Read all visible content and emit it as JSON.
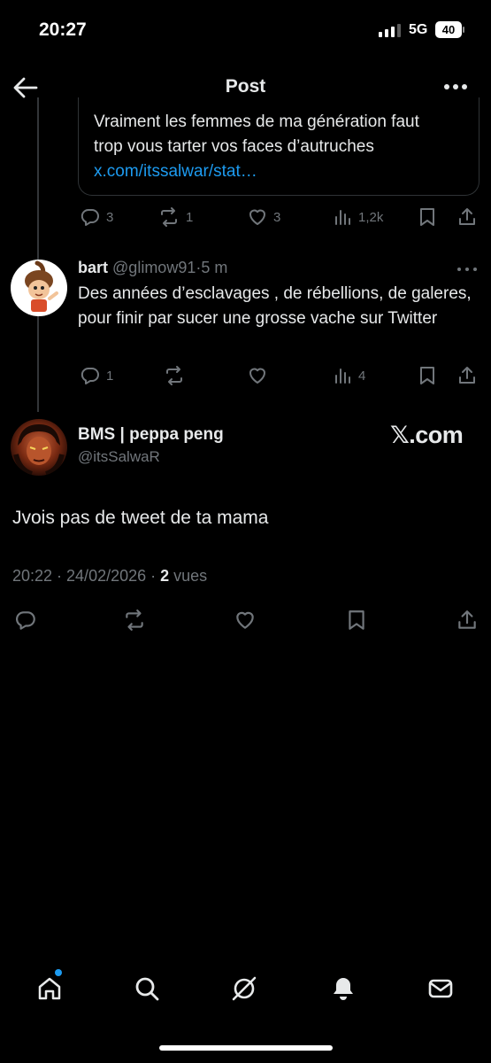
{
  "status_bar": {
    "time": "20:27",
    "network": "5G",
    "battery": "40"
  },
  "header": {
    "title": "Post"
  },
  "quoted_post": {
    "line1": "Vraiment les femmes de ma génération faut",
    "line2": "trop vous tarter vos faces d’autruches",
    "link": "x.com/itssalwar/stat…",
    "replies": "3",
    "reposts": "1",
    "likes": "3",
    "views": "1,2k"
  },
  "reply": {
    "name": "bart",
    "handle": "@glimow91",
    "time": "5 m",
    "text": "Des années d’esclavages , de rébellions, de galeres, pour finir par sucer une grosse vache sur Twitter",
    "replies": "1",
    "reposts": "",
    "likes": "",
    "views": "4"
  },
  "main_post": {
    "name": "BMS | peppa peng",
    "handle": "@itsSalwaR",
    "watermark": "𝕏.com",
    "text": "Jvois pas de tweet de ta mama",
    "timestamp": "20:22 · 24/02/2026 · ",
    "views_count": "2",
    "views_label": " vues"
  },
  "colors": {
    "accent": "#1d9bf0",
    "muted": "#71767b",
    "text": "#e7e9ea",
    "border": "#2f3336"
  },
  "icons": [
    "arrow-left-icon",
    "more-icon",
    "reply-icon",
    "repost-icon",
    "like-icon",
    "views-icon",
    "bookmark-icon",
    "share-icon",
    "home-icon",
    "search-icon",
    "grok-icon",
    "notifications-icon",
    "messages-icon"
  ]
}
